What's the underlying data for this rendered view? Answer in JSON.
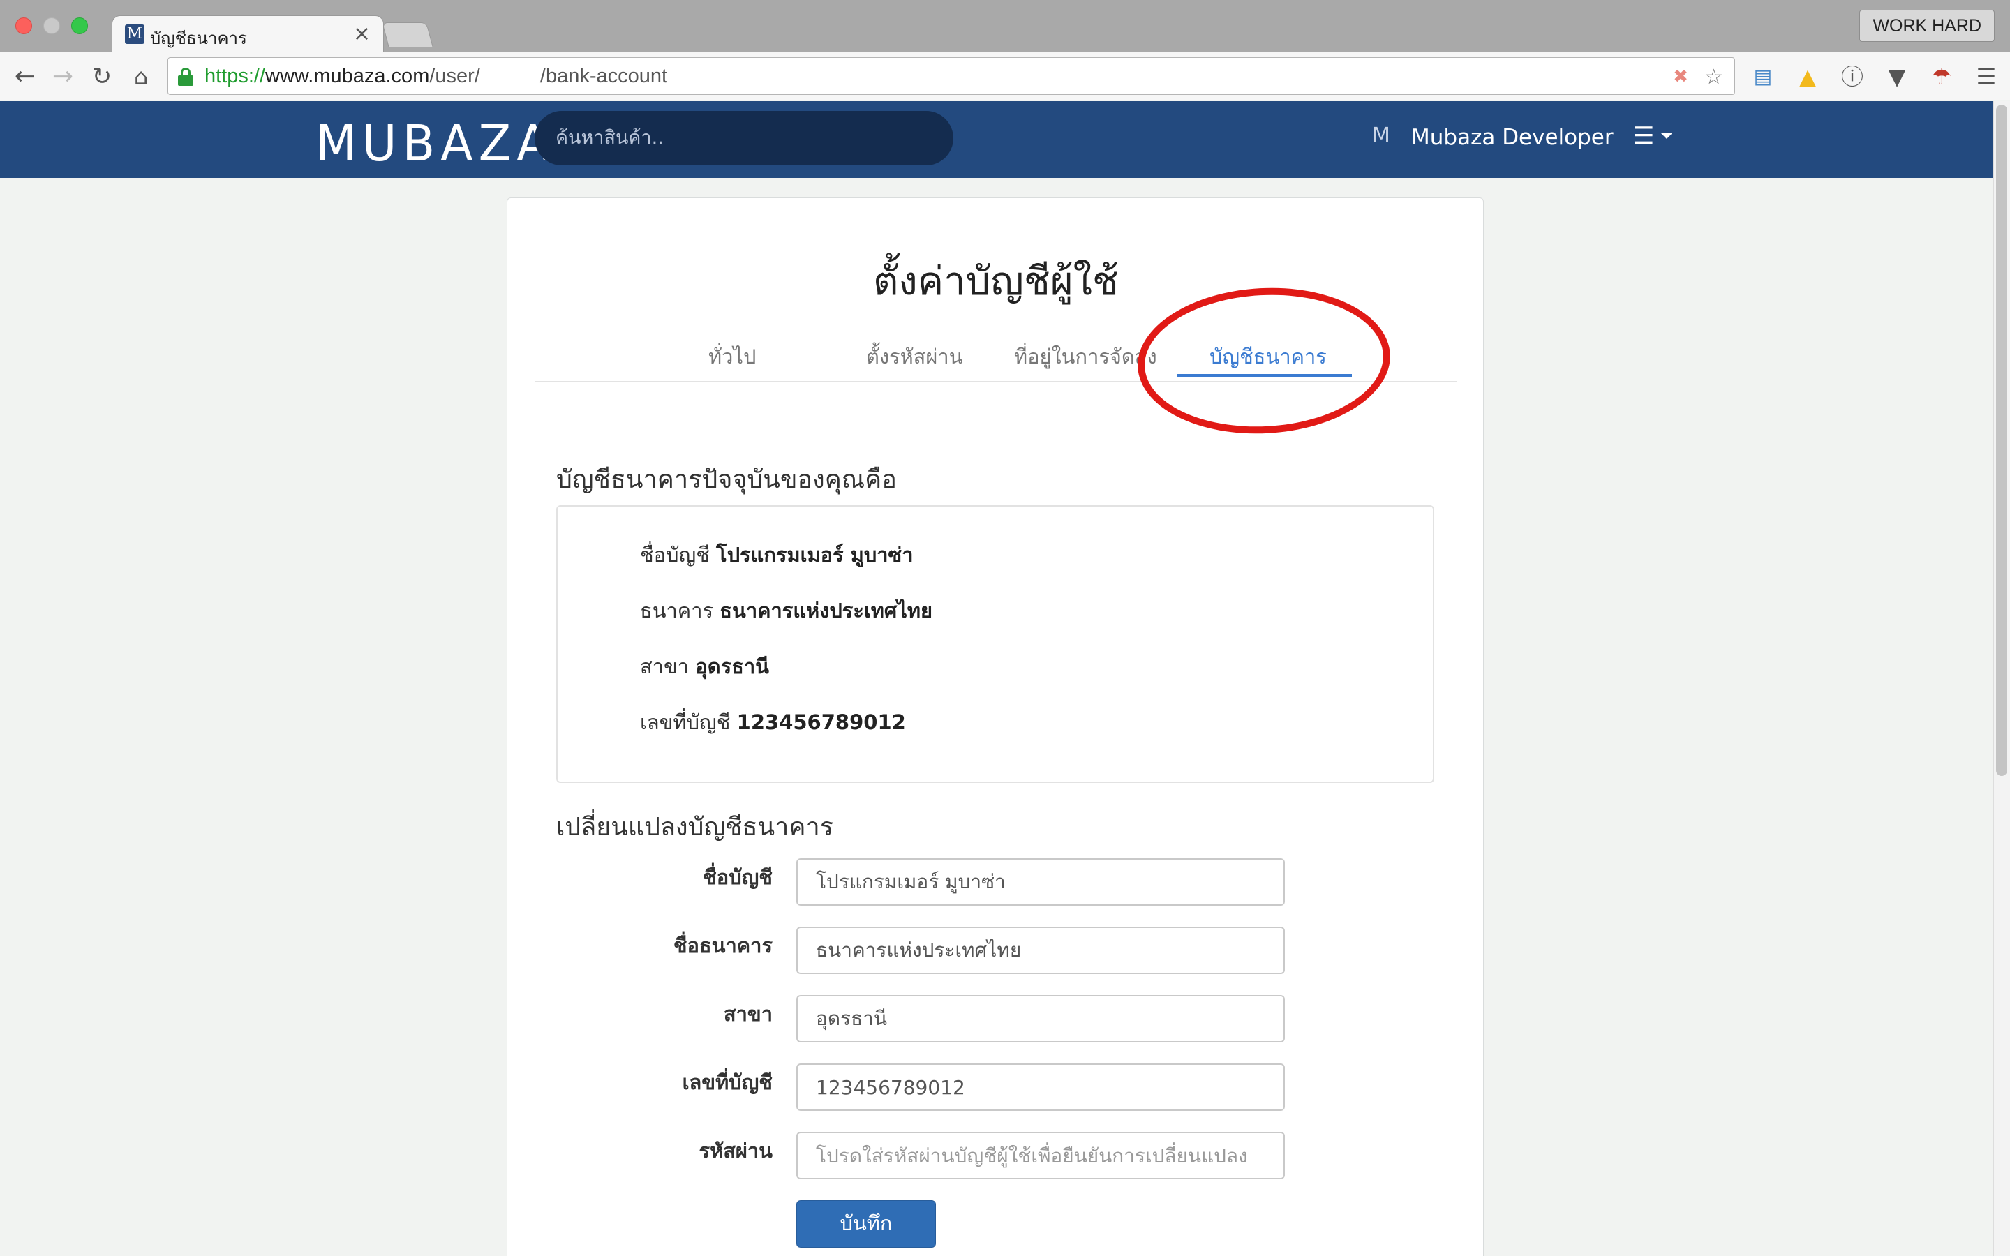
{
  "browser": {
    "tab_title": "บัญชีธนาคาร",
    "tab_close": "×",
    "profile_label": "WORK HARD",
    "url_scheme": "https://",
    "url_host": "www.mubaza.com",
    "url_path_prefix": "/user/",
    "url_path_suffix": "/bank-account"
  },
  "header": {
    "logo": "MUBAZA",
    "search_placeholder": "ค้นหาสินค้า..",
    "user_name": "Mubaza Developer",
    "user_logo": "M"
  },
  "page": {
    "title": "ตั้งค่าบัญชีผู้ใช้",
    "tabs": [
      {
        "label": "ทั่วไป",
        "active": false
      },
      {
        "label": "ตั้งรหัสผ่าน",
        "active": false
      },
      {
        "label": "ที่อยู่ในการจัดส่ง",
        "active": false
      },
      {
        "label": "บัญชีธนาคาร",
        "active": true
      }
    ],
    "accent_color": "#3b7bd1",
    "annotation_color": "#e11a16"
  },
  "current_account": {
    "heading": "บัญชีธนาคารปัจจุบันของคุณคือ",
    "rows": [
      {
        "label": "ชื่อบัญชี",
        "value": "โปรแกรมเมอร์ มูบาซ่า"
      },
      {
        "label": "ธนาคาร",
        "value": "ธนาคารแห่งประเทศไทย"
      },
      {
        "label": "สาขา",
        "value": "อุดรธานี"
      },
      {
        "label": "เลขที่บัญชี",
        "value": "123456789012"
      }
    ]
  },
  "change_form": {
    "heading": "เปลี่ยนแปลงบัญชีธนาคาร",
    "fields": [
      {
        "label": "ชื่อบัญชี",
        "value": "โปรแกรมเมอร์ มูบาซ่า",
        "placeholder": ""
      },
      {
        "label": "ชื่อธนาคาร",
        "value": "ธนาคารแห่งประเทศไทย",
        "placeholder": ""
      },
      {
        "label": "สาขา",
        "value": "อุดรธานี",
        "placeholder": ""
      },
      {
        "label": "เลขที่บัญชี",
        "value": "123456789012",
        "placeholder": ""
      },
      {
        "label": "รหัสผ่าน",
        "value": "",
        "placeholder": "โปรดใส่รหัสผ่านบัญชีผู้ใช้เพื่อยืนยันการเปลี่ยนแปลง"
      }
    ],
    "submit_label": "บันทึก"
  }
}
